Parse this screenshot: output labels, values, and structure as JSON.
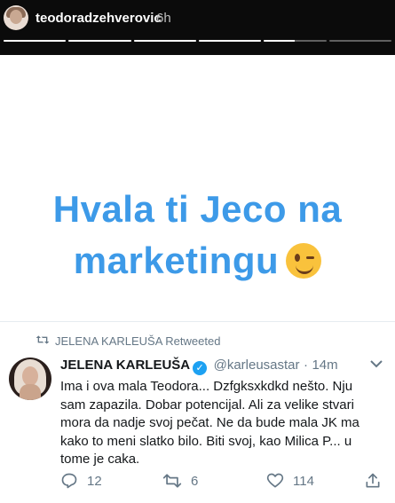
{
  "story": {
    "username": "teodoradzehverovic",
    "time": "6h",
    "progress": [
      1,
      1,
      1,
      1,
      0.5,
      0
    ]
  },
  "caption": {
    "line1": "Hvala ti Jeco na",
    "line2": "marketingu",
    "emoji": "winking-face"
  },
  "tweet": {
    "retweet_label": "JELENA KARLEUŠA Retweeted",
    "name": "JELENA KARLEUŠA",
    "handle": "@karleusastar",
    "dot": "·",
    "time": "14m",
    "text": "Ima i ova mala Teodora... Dzfgksxkdkd nešto. Nju sam zapazila. Dobar potencijal. Ali za velike stvari mora da nadje svoj pečat. Ne da bude mala JK ma kako to meni slatko bilo. Biti svoj, kao Milica P... u tome je caka.",
    "reply_count": "12",
    "retweet_count": "6",
    "like_count": "114"
  },
  "colors": {
    "caption": "#3d9ae8",
    "verified": "#1da1f2",
    "muted": "#657786"
  }
}
